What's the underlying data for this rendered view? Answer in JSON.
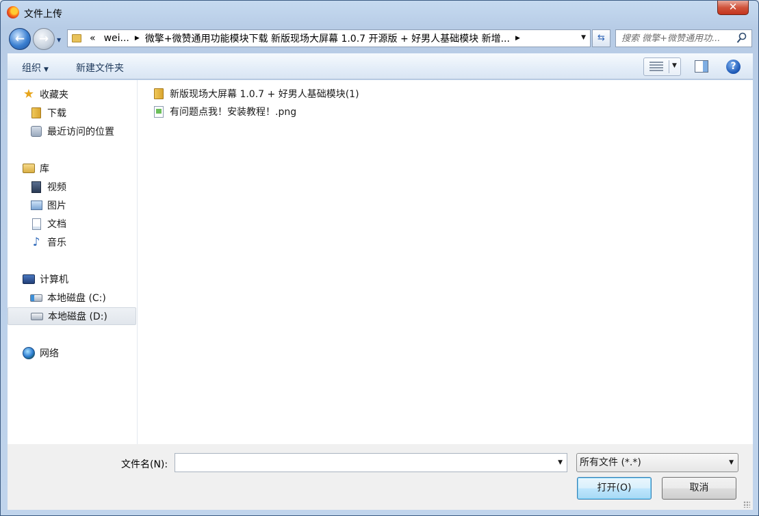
{
  "window": {
    "title": "文件上传",
    "close_label": "✕"
  },
  "nav": {
    "back_icon": "back-arrow-icon",
    "forward_icon": "forward-arrow-icon",
    "address": {
      "overflow": "«",
      "segments": [
        "wei...",
        "微擎+微赞通用功能模块下载 新版现场大屏幕 1.0.7 开源版 + 好男人基础模块 新增..."
      ]
    },
    "search": {
      "placeholder": "搜索 微擎+微赞通用功..."
    }
  },
  "toolbar": {
    "organize_label": "组织",
    "new_folder_label": "新建文件夹"
  },
  "sidebar": {
    "favorites": {
      "label": "收藏夹",
      "items": [
        "下载",
        "最近访问的位置"
      ]
    },
    "libraries": {
      "label": "库",
      "items": [
        "视频",
        "图片",
        "文档",
        "音乐"
      ]
    },
    "computer": {
      "label": "计算机",
      "items": [
        "本地磁盘 (C:)",
        "本地磁盘 (D:)"
      ],
      "selected": "本地磁盘 (D:)"
    },
    "network": {
      "label": "网络"
    }
  },
  "files": [
    {
      "name": "新版现场大屏幕 1.0.7 + 好男人基础模块(1)",
      "type": "folder"
    },
    {
      "name": "有问题点我！安装教程！.png",
      "type": "png"
    }
  ],
  "bottom": {
    "filename_label": "文件名(N):",
    "filename_value": "",
    "filetype_value": "所有文件 (*.*)",
    "open_label": "打开(O)",
    "cancel_label": "取消"
  },
  "colors": {
    "accent": "#3c7fb1",
    "close": "#c4341d",
    "folder": "#e8c25a"
  }
}
